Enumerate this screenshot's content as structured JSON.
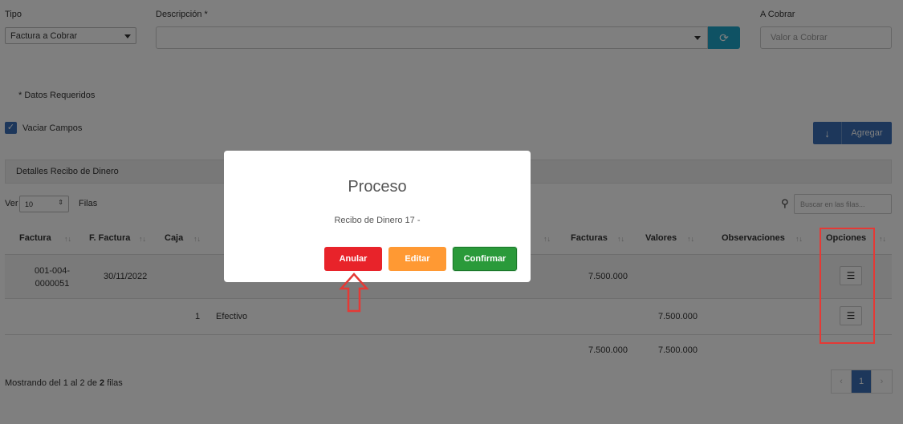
{
  "form": {
    "tipo_label": "Tipo",
    "tipo_value": "Factura a Cobrar",
    "descripcion_label": "Descripción *",
    "descripcion_value": "",
    "a_cobrar_label": "A Cobrar",
    "a_cobrar_placeholder": "Valor a Cobrar",
    "required_note": "* Datos Requeridos",
    "vaciar_label": "Vaciar Campos",
    "vaciar_checked": true,
    "agregar_label": "Agregar"
  },
  "details": {
    "header": "Detalles Recibo de Dinero",
    "ver_label": "Ver",
    "ver_value": "10",
    "filas_label": "Filas",
    "search_placeholder": "Buscar en las filas...",
    "columns": [
      "Factura",
      "F. Factura",
      "Caja",
      "",
      "",
      "Facturas",
      "Valores",
      "Observaciones",
      "Opciones"
    ],
    "rows": [
      {
        "factura": "001-004-0000051",
        "fecha": "30/11/2022",
        "caja": "",
        "tipo": "",
        "facturas": "7.500.000",
        "valores": "",
        "observaciones": ""
      },
      {
        "factura": "",
        "fecha": "",
        "caja": "1",
        "tipo": "Efectivo",
        "facturas": "",
        "valores": "7.500.000",
        "observaciones": ""
      }
    ],
    "totals": {
      "facturas": "7.500.000",
      "valores": "7.500.000"
    },
    "footer": {
      "prefix": "Mostrando del 1 al 2 de ",
      "count": "2",
      "suffix": " filas"
    },
    "pagination": {
      "prev": "‹",
      "page": "1",
      "next": "›"
    }
  },
  "modal": {
    "title": "Proceso",
    "message": "Recibo de Dinero 17 -",
    "anular": "Anular",
    "editar": "Editar",
    "confirmar": "Confirmar"
  },
  "colors": {
    "primary": "#3a6fb6",
    "refresh": "#1fa4c9",
    "anular": "#e8232a",
    "editar": "#ff9933",
    "confirmar": "#2a9a3a",
    "annotation": "#e53935"
  },
  "icons": {
    "refresh": "refresh-icon",
    "add": "arrow-down-icon",
    "search": "search-icon",
    "options": "list-icon",
    "annotation_arrow": "arrow-up-outline-icon"
  }
}
